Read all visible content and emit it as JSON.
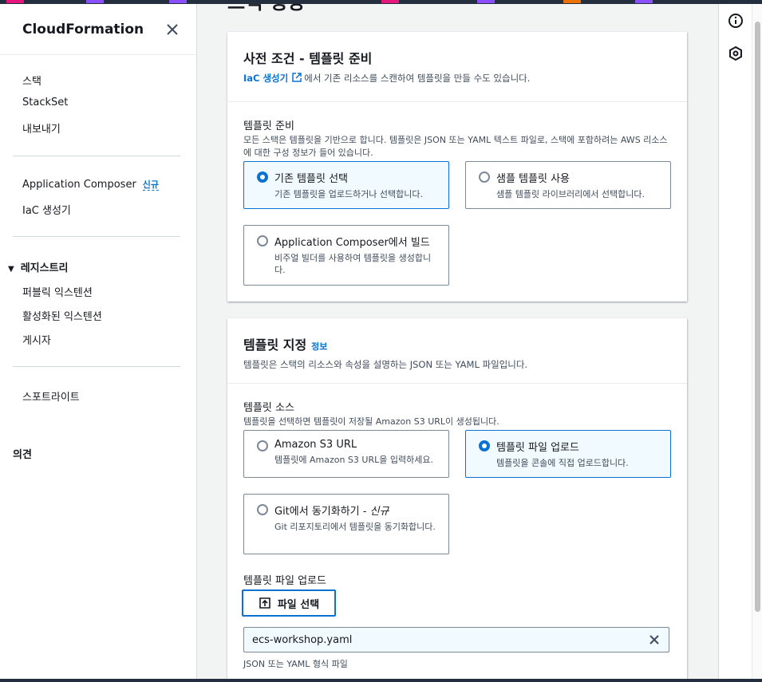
{
  "colors": {
    "accent": "#0972d3",
    "selected_bg": "#f1faff",
    "nav_bg": "#232f3e"
  },
  "sidebar": {
    "title": "CloudFormation",
    "close_icon": "close-icon",
    "items_top": [
      "스택",
      "StackSet",
      "내보내기"
    ],
    "composer": {
      "label": "Application Composer",
      "badge": "신규"
    },
    "iac_generator": "IaC 생성기",
    "registry": {
      "label": "레지스트리",
      "items": [
        "퍼블릭 익스텐션",
        "활성화된 익스텐션",
        "게시자"
      ]
    },
    "spotlight": "스포트라이트",
    "feedback": "의견"
  },
  "main": {
    "page_title_partial": "스택 생성",
    "prereq": {
      "title": "사전 조건 - 템플릿 준비",
      "link_text": "IaC 생성기",
      "desc_after_link": "에서 기존 리소스를 스캔하여 템플릿을 만들 수도 있습니다.",
      "field_label": "템플릿 준비",
      "field_desc": "모든 스택은 템플릿을 기반으로 합니다. 템플릿은 JSON 또는 YAML 텍스트 파일로, 스택에 포함하려는 AWS 리소스에 대한 구성 정보가 들어 있습니다.",
      "options": [
        {
          "title": "기존 템플릿 선택",
          "desc": "기존 템플릿을 업로드하거나 선택합니다.",
          "selected": true
        },
        {
          "title": "샘플 템플릿 사용",
          "desc": "샘플 템플릿 라이브러리에서 선택합니다.",
          "selected": false
        },
        {
          "title": "Application Composer에서 빌드",
          "desc": "비주얼 빌더를 사용하여 템플릿을 생성합니다.",
          "selected": false
        }
      ]
    },
    "specify": {
      "title": "템플릿 지정",
      "info_link": "정보",
      "desc": "템플릿은 스택의 리소스와 속성을 설명하는 JSON 또는 YAML 파일입니다.",
      "source_label": "템플릿 소스",
      "source_desc": "템플릿을 선택하면 템플릿이 저장될 Amazon S3 URL이 생성됩니다.",
      "options": [
        {
          "title": "Amazon S3 URL",
          "desc": "템플릿에 Amazon S3 URL을 입력하세요.",
          "selected": false
        },
        {
          "title": "템플릿 파일 업로드",
          "desc": "템플릿을 콘솔에 직접 업로드합니다.",
          "selected": true
        },
        {
          "title": "Git에서 동기화하기 - ",
          "title_em": "신규",
          "desc": "Git 리포지토리에서 템플릿을 동기화합니다.",
          "selected": false
        }
      ],
      "upload_label": "템플릿 파일 업로드",
      "upload_button": "파일 선택",
      "file_name": "ecs-workshop.yaml",
      "file_hint": "JSON 또는 YAML 형식 파일"
    }
  },
  "rail": {
    "icons": [
      "info-icon",
      "settings-hex-icon"
    ]
  }
}
